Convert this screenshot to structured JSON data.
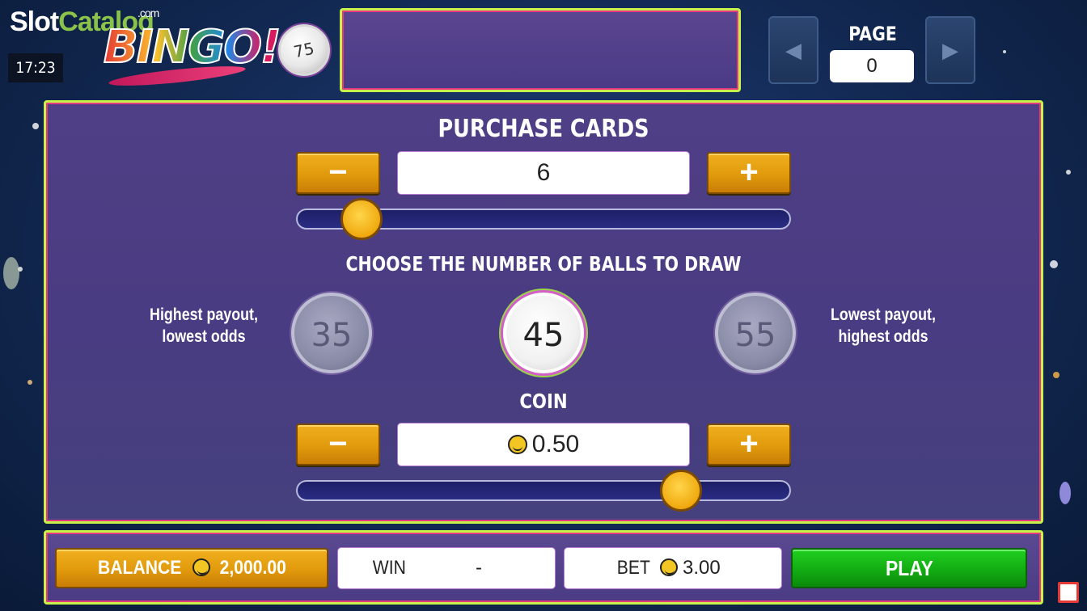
{
  "watermark": {
    "slot": "Slot",
    "catalog": "Catalog",
    "com": ".com"
  },
  "clock": "17:23",
  "logo": {
    "text": "BINGO!",
    "ball_number": "75"
  },
  "page_nav": {
    "label": "PAGE",
    "value": "0",
    "prev_icon": "◀",
    "next_icon": "▶"
  },
  "purchase": {
    "title": "PURCHASE CARDS",
    "minus": "−",
    "plus": "+",
    "value": "6",
    "slider_level": 0.13
  },
  "balls": {
    "title": "CHOOSE THE NUMBER OF BALLS TO DRAW",
    "left_note_1": "Highest payout,",
    "left_note_2": "lowest odds",
    "right_note_1": "Lowest payout,",
    "right_note_2": "highest odds",
    "options": [
      "35",
      "45",
      "55"
    ],
    "selected": "45"
  },
  "coin": {
    "title": "COIN",
    "minus": "−",
    "plus": "+",
    "value": "0.50",
    "slider_level": 0.78
  },
  "bottom": {
    "balance_label": "BALANCE",
    "balance_value": "2,000.00",
    "win_label": "WIN",
    "win_value": "-",
    "bet_label": "BET",
    "bet_value": "3.00",
    "play_label": "PLAY"
  },
  "colors": {
    "accent_gold": "#e19a0c",
    "play_green": "#12a812",
    "panel_purple": "#4f3f86",
    "border_lime": "#c6f24a",
    "border_pink": "#e53981"
  }
}
